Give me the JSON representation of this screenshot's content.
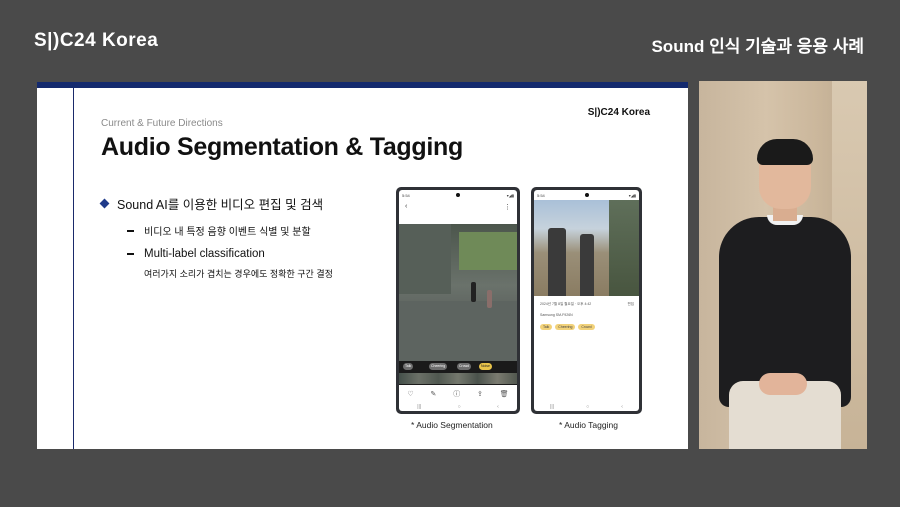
{
  "header": {
    "brand": "S|)C24 Korea",
    "session_title": "Sound 인식 기술과 응용 사례"
  },
  "slide": {
    "brand": "S|)C24 Korea",
    "kicker": "Current & Future Directions",
    "title": "Audio Segmentation & Tagging",
    "bullet_main": "Sound AI를 이용한 비디오 편집 및 검색",
    "sub_bullets": [
      "비디오 내 특정 음향 이벤트 식별 및 분할",
      "Multi-label classification"
    ],
    "sub_note": "여러가지 소리가 겹치는 경우에도 정확한 구간 결정",
    "caption_left": "* Audio Segmentation",
    "caption_right": "* Audio Tagging"
  },
  "phone_left": {
    "status_time": "5:54",
    "status_icons": "▾◢▮",
    "back": "‹",
    "menu": "⋮",
    "chips": [
      "Talk",
      "Cheering",
      "Crowd",
      "Noise"
    ],
    "bottom_icons": [
      "♡",
      "✎",
      "ⓘ",
      "⇪",
      "🗑"
    ],
    "nav": [
      "|||",
      "○",
      "‹"
    ]
  },
  "phone_right": {
    "status_time": "5:54",
    "status_icons": "▾◢▮",
    "info_lines": [
      "2024년 7월 8일 월요일 · 오후 4:42",
      "Samsung SM-F926N"
    ],
    "edit": "편집",
    "tags": [
      "Talk",
      "Cheering",
      "Crowd"
    ],
    "nav": [
      "|||",
      "○",
      "‹"
    ]
  },
  "colors": {
    "background": "#4a4a4a",
    "slide_accent": "#142a6e",
    "bullet_diamond": "#1f3a8a",
    "tag_yellow": "#f2d27a"
  }
}
